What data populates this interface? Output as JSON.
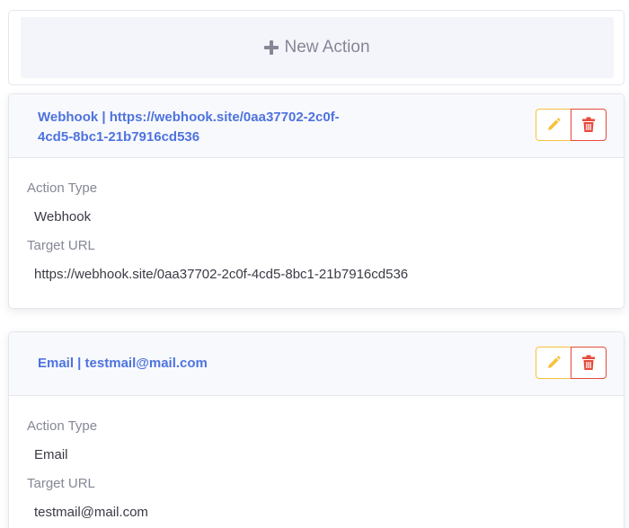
{
  "new_action": {
    "label": "New Action",
    "icon": "plus-icon"
  },
  "actions": [
    {
      "title_line1": "Webhook | https://webhook.site/0aa37702-2c0f-",
      "title_line2": "4cd5-8bc1-21b7916cd536",
      "action_type_label": "Action Type",
      "action_type_value": "Webhook",
      "target_url_label": "Target URL",
      "target_url_value": "https://webhook.site/0aa37702-2c0f-4cd5-8bc1-21b7916cd536"
    },
    {
      "title_line1": "Email | testmail@mail.com",
      "action_type_label": "Action Type",
      "action_type_value": "Email",
      "target_url_label": "Target URL",
      "target_url_value": "testmail@mail.com"
    }
  ],
  "icons": {
    "edit": "pencil-icon",
    "delete": "trash-icon"
  },
  "colors": {
    "title": "#4e73df",
    "edit_accent": "#f6c23e",
    "delete_accent": "#e74a3b",
    "muted_text": "#858796",
    "body_text": "#3a3b45"
  }
}
